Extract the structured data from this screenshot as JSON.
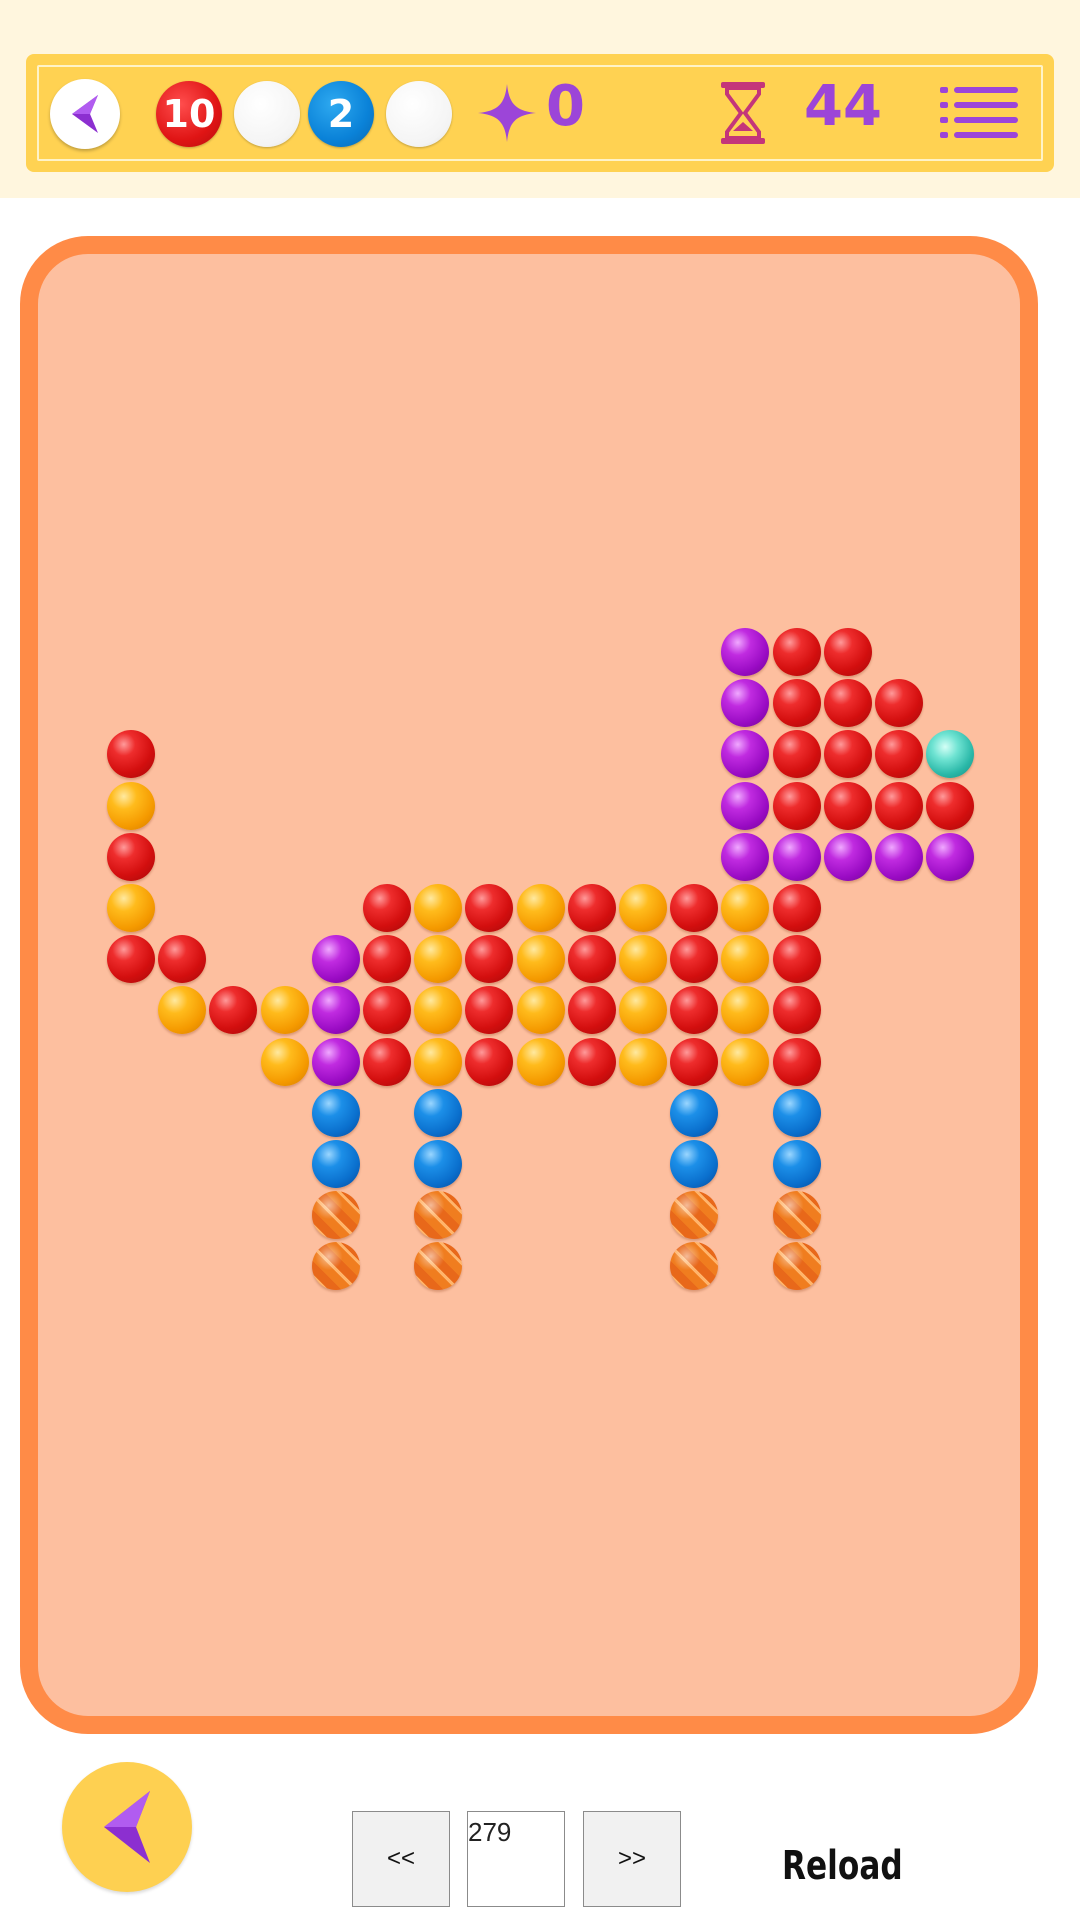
{
  "hud": {
    "red_count": "10",
    "blue_count": "2",
    "score": "0",
    "timer": "44",
    "icons": [
      "back-arrow-icon",
      "star-icon",
      "hourglass-icon",
      "menu-list-icon"
    ],
    "colors": {
      "panel": "#ffd252",
      "accent": "#9c45d8",
      "timer_icon": "#c4357a"
    }
  },
  "board": {
    "border_color": "#ff8b47",
    "background_color": "#fdbf9f",
    "balls": [
      {
        "col": 0,
        "row": 0,
        "color": "purple"
      },
      {
        "col": 1,
        "row": 0,
        "color": "red"
      },
      {
        "col": 2,
        "row": 0,
        "color": "red"
      }
    ]
  },
  "footer": {
    "prev_label": "<<",
    "page_value": "279",
    "next_label": ">>",
    "reload_label": "Reload"
  }
}
